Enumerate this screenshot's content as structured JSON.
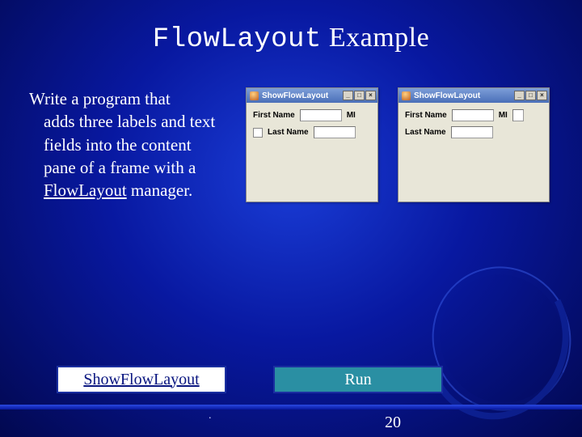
{
  "title": {
    "code": "FlowLayout",
    "rest": " Example"
  },
  "description": {
    "line1": "Write a program that",
    "rest": "adds three labels and text fields into the content pane of a frame with a ",
    "link": "FlowLayout",
    "tail": " manager."
  },
  "windows": {
    "title": "ShowFlowLayout",
    "labels": {
      "first": "First Name",
      "mi": "MI",
      "last": "Last Name"
    },
    "controls": {
      "min": "_",
      "max": "□",
      "close": "×"
    }
  },
  "buttons": {
    "left": "ShowFlowLayout",
    "right": "Run"
  },
  "page": "20",
  "dot": "."
}
